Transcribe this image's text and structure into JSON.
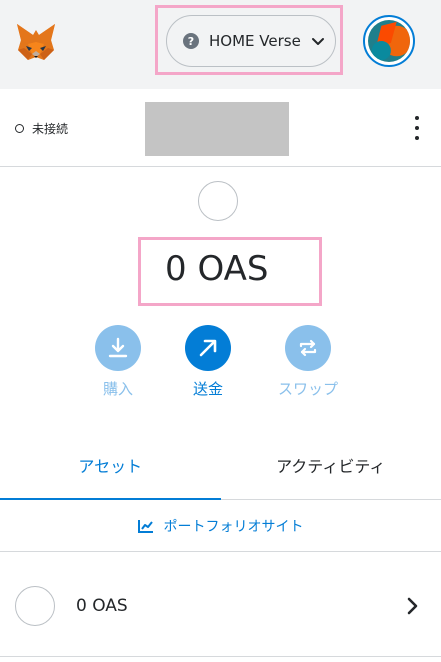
{
  "header": {
    "logo_icon": "metamask-fox-icon",
    "network_label": "HOME Verse",
    "network_icon": "question-icon",
    "network_icon_glyph": "?",
    "dropdown_icon": "chevron-down-icon",
    "avatar_icon": "account-avatar-icon"
  },
  "account": {
    "connection_status": "未接続",
    "menu_icon": "kebab-menu-icon"
  },
  "balance": {
    "amount": "0 OAS"
  },
  "actions": [
    {
      "label": "購入",
      "icon": "download-icon",
      "enabled": true
    },
    {
      "label": "送金",
      "icon": "arrow-up-right-icon",
      "enabled": true
    },
    {
      "label": "スワップ",
      "icon": "swap-icon",
      "enabled": false
    }
  ],
  "tabs": [
    {
      "label": "アセット",
      "active": true
    },
    {
      "label": "アクティビティ",
      "active": false
    }
  ],
  "portfolio": {
    "label": "ポートフォリオサイト",
    "icon": "chart-line-icon"
  },
  "assets": [
    {
      "label": "0 OAS",
      "icon": "token-placeholder-icon",
      "chevron": "chevron-right-icon"
    }
  ],
  "colors": {
    "primary": "#037dd6",
    "primary_muted": "#8ac0eb",
    "highlight": "#f4a6c8",
    "header_bg": "#f2f3f4",
    "text": "#24272a"
  }
}
